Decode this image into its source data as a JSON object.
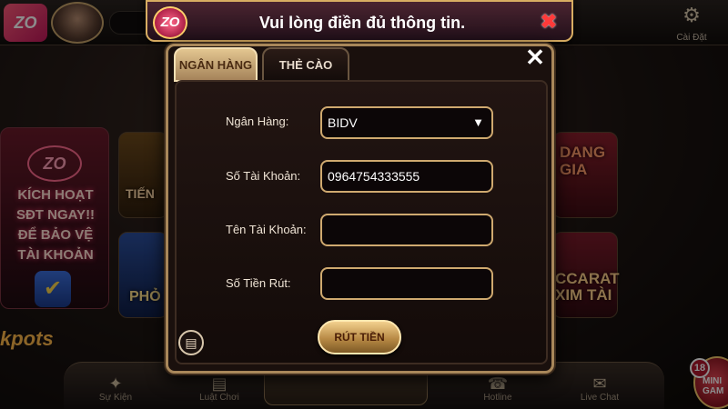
{
  "background": {
    "logo_text": "ZO",
    "settings_label": "Cài Đặt",
    "settings_icon": "gear-icon",
    "promo_logo": "ZO",
    "promo_lines": "KÍCH HOẠT SĐT NGAY!! ĐỂ BẢO VỆ TÀI KHOẢN",
    "tiles": [
      "TIẾN",
      "PHỎ",
      "DANG GIA",
      "CCARAT XIM TÀI"
    ],
    "bottom_nav": [
      "Sự Kiện",
      "Luật Chơi",
      "Hotline",
      "Live Chat"
    ],
    "center_button_text": "RÚT TIỀN",
    "jackpot_text": "kpots",
    "mini_game_label": "MINI GAM",
    "mini_game_badge": "18"
  },
  "toast": {
    "logo_text": "ZO",
    "message": "Vui lòng điền đủ thông tin.",
    "close_icon": "close-icon"
  },
  "modal": {
    "tabs": [
      {
        "label": "NGÂN HÀNG",
        "active": true
      },
      {
        "label": "THẺ CÀO",
        "active": false
      }
    ],
    "close_glyph": "✕",
    "form": {
      "bank_label": "Ngân Hàng:",
      "bank_value": "BIDV",
      "account_number_label": "Số Tài Khoản:",
      "account_number_value": "0964754333555",
      "account_name_label": "Tên Tài Khoản:",
      "account_name_value": "",
      "amount_label": "Số Tiền Rút:",
      "amount_value": ""
    },
    "submit_label": "RÚT TIỀN",
    "history_icon": "history-icon"
  },
  "colors": {
    "accent_gold": "#cfa96f",
    "panel_bg": "#1a100d",
    "toast_close": "#ff3a3a"
  }
}
